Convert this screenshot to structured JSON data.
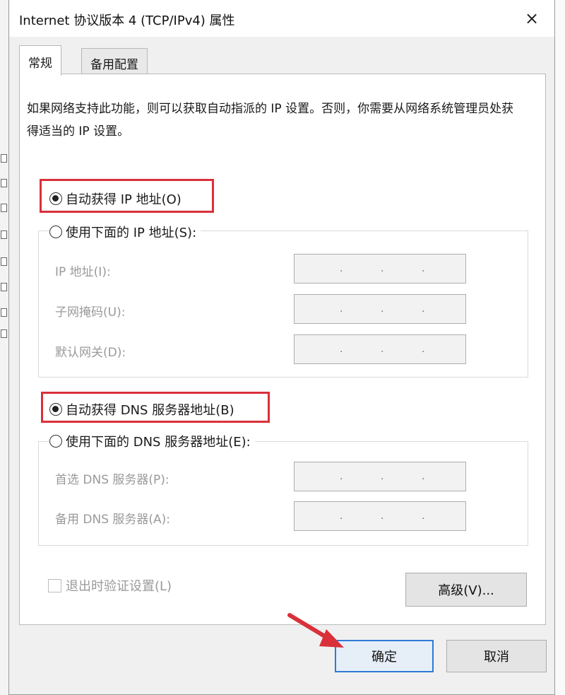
{
  "dialog": {
    "title": "Internet 协议版本 4 (TCP/IPv4) 属性",
    "close_icon": "×"
  },
  "tabs": [
    {
      "label": "常规",
      "active": true
    },
    {
      "label": "备用配置",
      "active": false
    }
  ],
  "description": "如果网络支持此功能，则可以获取自动指派的 IP 设置。否则，你需要从网络系统管理员处获得适当的 IP 设置。",
  "ip": {
    "auto_label": "自动获得 IP 地址(O)",
    "auto_selected": true,
    "manual_label": "使用下面的 IP 地址(S):",
    "manual_selected": false,
    "fields": [
      {
        "label": "IP 地址(I):",
        "value": ". . ."
      },
      {
        "label": "子网掩码(U):",
        "value": ". . ."
      },
      {
        "label": "默认网关(D):",
        "value": ". . ."
      }
    ]
  },
  "dns": {
    "auto_label": "自动获得 DNS 服务器地址(B)",
    "auto_selected": true,
    "manual_label": "使用下面的 DNS 服务器地址(E):",
    "manual_selected": false,
    "fields": [
      {
        "label": "首选 DNS 服务器(P):",
        "value": ". . ."
      },
      {
        "label": "备用 DNS 服务器(A):",
        "value": ". . ."
      }
    ]
  },
  "validate_label": "退出时验证设置(L)",
  "advanced_label": "高级(V)...",
  "ok_label": "确定",
  "cancel_label": "取消",
  "highlight_color": "#d9303a",
  "background_fragments": {
    "left": [
      "",
      "",
      "",
      "",
      "",
      ""
    ],
    "right": [
      "",
      "",
      "",
      "",
      "",
      "",
      "",
      "",
      "",
      "",
      "",
      "",
      "",
      "",
      ""
    ],
    "bottom": ""
  }
}
